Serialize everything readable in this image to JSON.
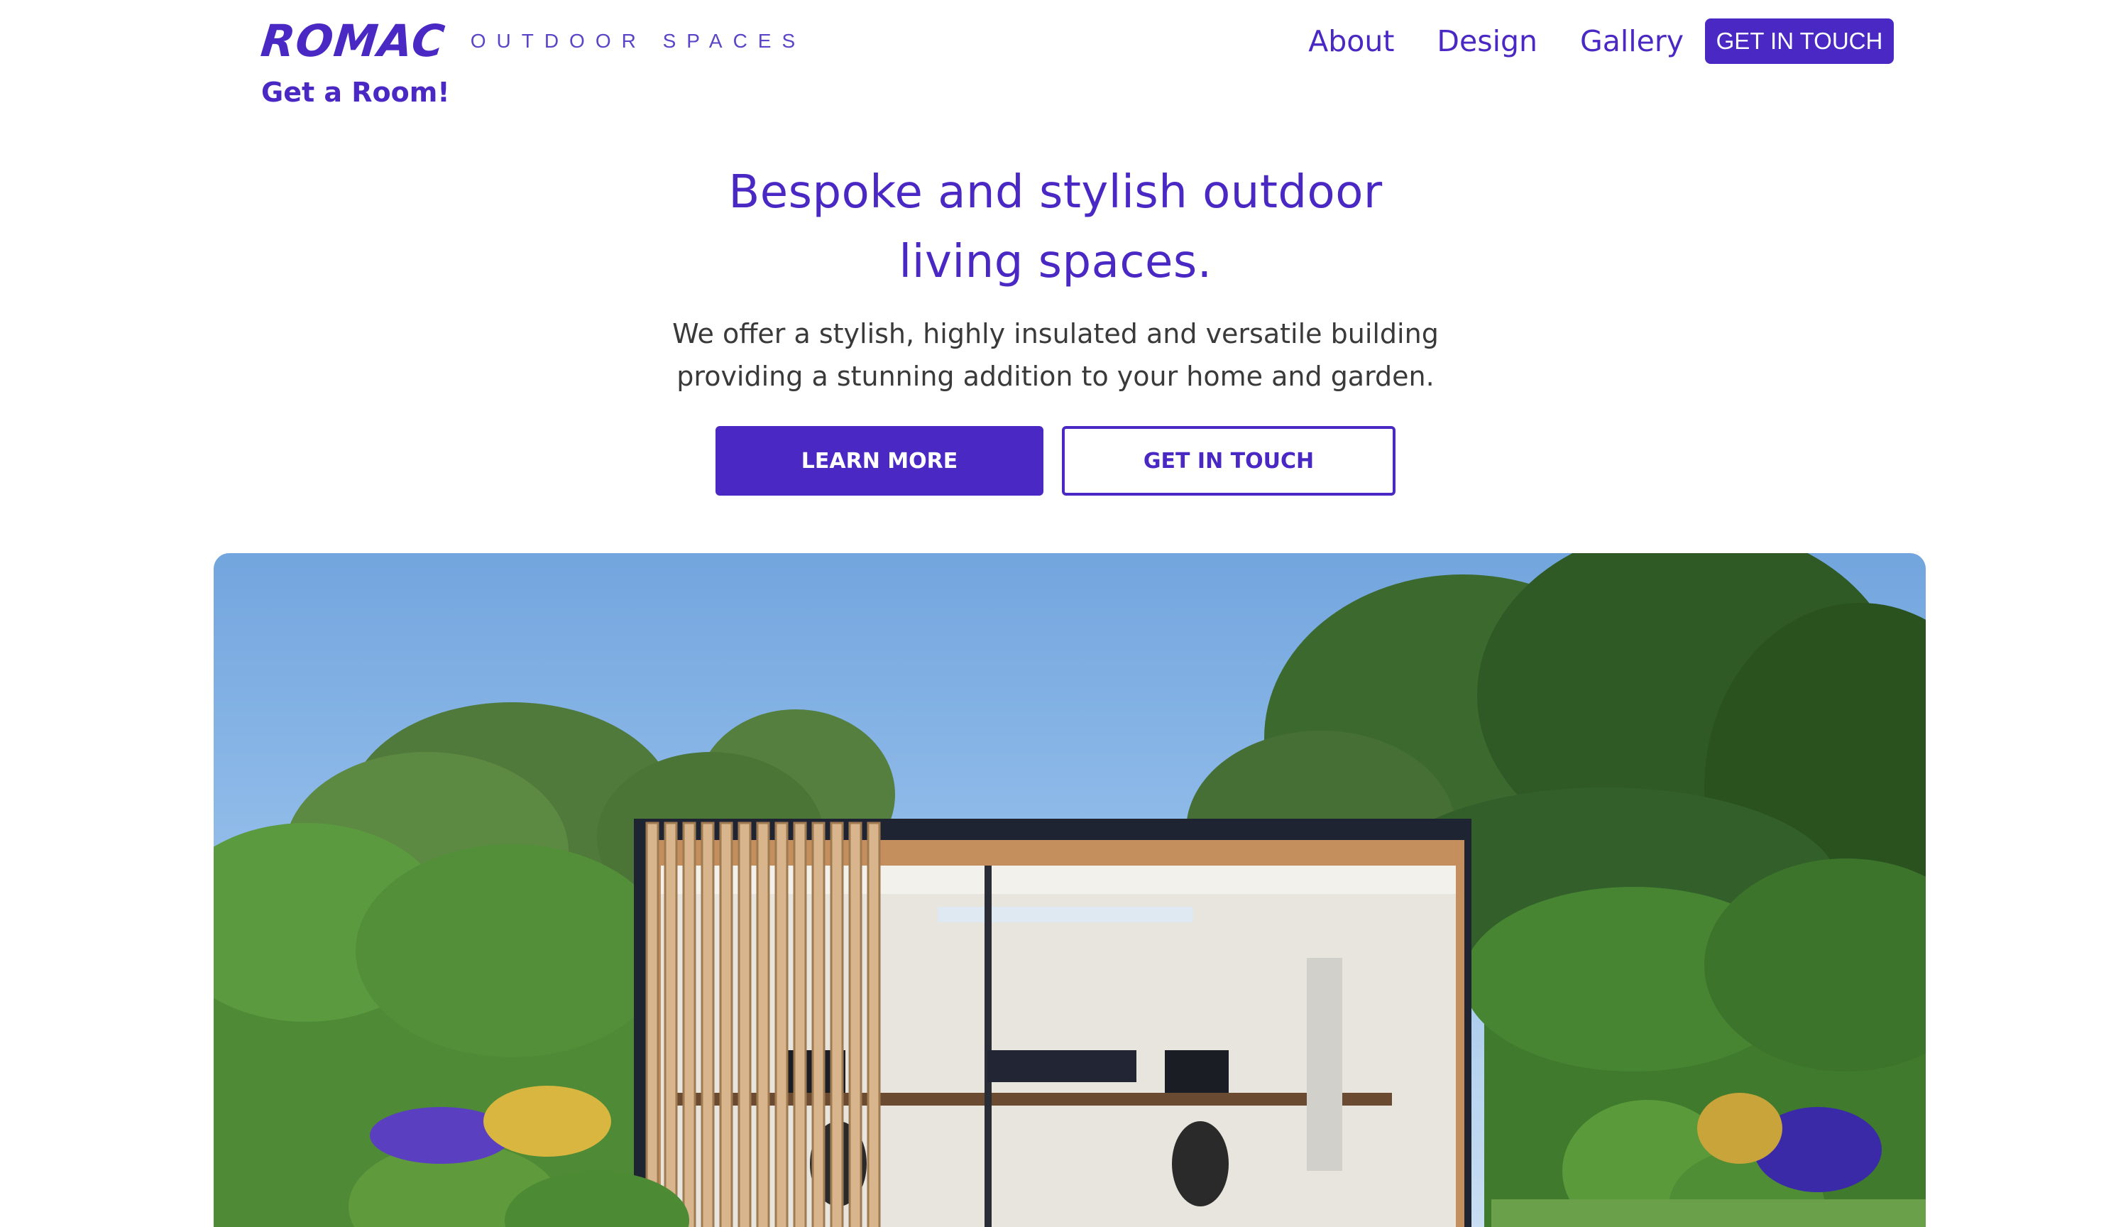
{
  "header": {
    "logo": "ROMAC",
    "logo_subtitle": "OUTDOOR SPACES",
    "tagline": "Get a Room!",
    "nav": [
      {
        "label": "About"
      },
      {
        "label": "Design"
      },
      {
        "label": "Gallery"
      }
    ],
    "cta_label": "GET IN TOUCH"
  },
  "hero": {
    "title_line1": "Bespoke and stylish outdoor",
    "title_line2": "living spaces.",
    "desc_line1": "We offer a stylish, highly insulated and versatile building",
    "desc_line2": "providing a stunning addition to your home and garden.",
    "primary_button": "LEARN MORE",
    "secondary_button": "GET IN TOUCH"
  },
  "colors": {
    "brand": "#4a28c4",
    "body_text": "#3a3a3a",
    "background": "#ffffff"
  },
  "icons": {
    "hero_image": "garden-office-photo"
  }
}
